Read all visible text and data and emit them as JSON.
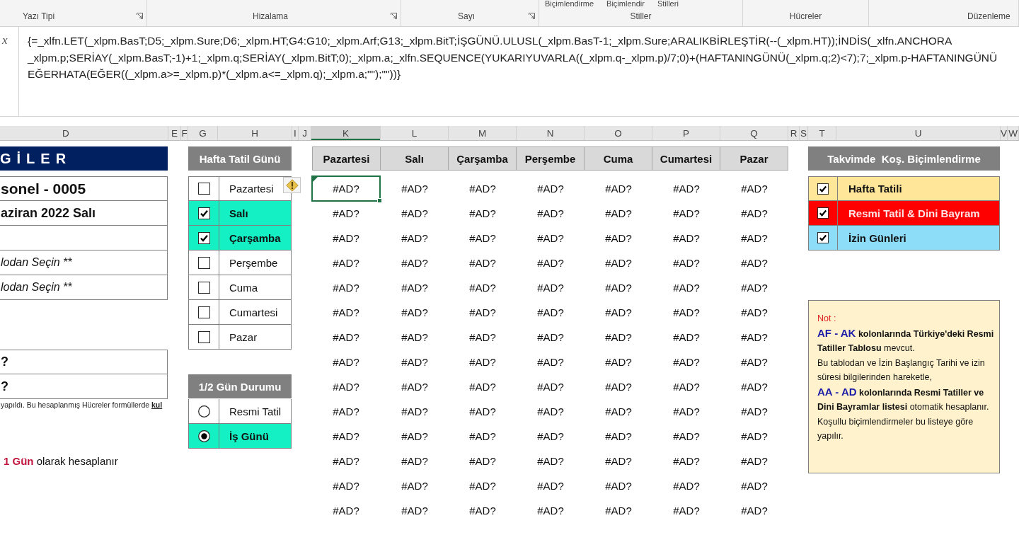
{
  "ribbon": {
    "groups": [
      {
        "label": "Yazı Tipi",
        "launcher": true
      },
      {
        "label": "Hizalama",
        "launcher": true
      },
      {
        "label": "Sayı",
        "launcher": true
      },
      {
        "label": "Stiller",
        "launcher": false,
        "button_labels": [
          "Biçimlendirme",
          "Biçimlendir",
          "Stilleri"
        ]
      },
      {
        "label": "Hücreler",
        "launcher": false
      },
      {
        "label": "Düzenleme",
        "launcher": false
      }
    ]
  },
  "formula_bar": {
    "function_button": "x",
    "lines": [
      "{=_xlfn.LET(_xlpm.BasT;D5;_xlpm.Sure;D6;_xlpm.HT;G4:G10;_xlpm.Arf;G13;_xlpm.BitT;İŞGÜNÜ.ULUSL(_xlpm.BasT-1;_xlpm.Sure;ARALIKBİRLEŞTİR(--(_xlpm.HT));İNDİS(_xlfn.ANCHORA",
      "_xlpm.p;SERİAY(_xlpm.BasT;-1)+1;_xlpm.q;SERİAY(_xlpm.BitT;0);_xlpm.a;_xlfn.SEQUENCE(YUKARIYUVARLA((_xlpm.q-_xlpm.p)/7;0)+(HAFTANINGÜNÜ(_xlpm.q;2)<7);7;_xlpm.p-HAFTANINGÜNÜ",
      "EĞERHATA(EĞER((_xlpm.a>=_xlpm.p)*(_xlpm.a<=_xlpm.q);_xlpm.a;\"\");\"\"))}"
    ]
  },
  "columns": [
    {
      "label": "D",
      "selected": false
    },
    {
      "label": "E",
      "selected": false
    },
    {
      "label": "F",
      "selected": false
    },
    {
      "label": "G",
      "selected": false
    },
    {
      "label": "H",
      "selected": false
    },
    {
      "label": "I",
      "selected": false
    },
    {
      "label": "J",
      "selected": false
    },
    {
      "label": "K",
      "selected": true
    },
    {
      "label": "L",
      "selected": false
    },
    {
      "label": "M",
      "selected": false
    },
    {
      "label": "N",
      "selected": false
    },
    {
      "label": "O",
      "selected": false
    },
    {
      "label": "P",
      "selected": false
    },
    {
      "label": "Q",
      "selected": false
    },
    {
      "label": "R",
      "selected": false
    },
    {
      "label": "S",
      "selected": false
    },
    {
      "label": "T",
      "selected": false
    },
    {
      "label": "U",
      "selected": false
    },
    {
      "label": "V",
      "selected": false
    },
    {
      "label": "W",
      "selected": false
    }
  ],
  "info_panel": {
    "title": "GİLER",
    "fields": [
      {
        "kind": "heading",
        "text": "sonel - 0005"
      },
      {
        "kind": "bold",
        "text": "aziran 2022 Salı"
      },
      {
        "kind": "blank"
      },
      {
        "kind": "italic",
        "text": "lodan Seçin **"
      },
      {
        "kind": "italic",
        "text": "lodan Seçin **"
      }
    ],
    "results": [
      {
        "kind": "bold",
        "text": "?"
      },
      {
        "kind": "bold",
        "text": "?"
      }
    ],
    "footnote": "yapıldı. Bu hesaplanmış Hücreler formüllerde **kul**",
    "summary": [
      {
        "kind": "highlight",
        "text": "1 Gün"
      },
      {
        "kind": "plain",
        "text": " olarak hesaplanır"
      }
    ]
  },
  "weekend_picker": {
    "title": "Hafta Tatil Günü",
    "days": [
      {
        "label": "Pazartesi",
        "checked": false
      },
      {
        "label": "Salı",
        "checked": true
      },
      {
        "label": "Çarşamba",
        "checked": true
      },
      {
        "label": "Perşembe",
        "checked": false
      },
      {
        "label": "Cuma",
        "checked": false
      },
      {
        "label": "Cumartesi",
        "checked": false
      },
      {
        "label": "Pazar",
        "checked": false
      }
    ]
  },
  "half_day": {
    "title": "1/2 Gün Durumu",
    "options": [
      {
        "label": "Resmi Tatil",
        "selected": false
      },
      {
        "label": "İş Günü",
        "selected": true
      }
    ]
  },
  "calendar": {
    "weekdays": [
      "Pazartesi",
      "Salı",
      "Çarşamba",
      "Perşembe",
      "Cuma",
      "Cumartesi",
      "Pazar"
    ],
    "rows": [
      {
        "cells": [
          {
            "text": "#AD?",
            "selected": true
          },
          {
            "text": "#AD?",
            "selected": false
          },
          {
            "text": "#AD?",
            "selected": false
          },
          {
            "text": "#AD?",
            "selected": false
          },
          {
            "text": "#AD?",
            "selected": false
          },
          {
            "text": "#AD?",
            "selected": false
          },
          {
            "text": "#AD?",
            "selected": false
          }
        ]
      },
      {
        "cells": [
          {
            "text": "#AD?",
            "selected": false
          },
          {
            "text": "#AD?",
            "selected": false
          },
          {
            "text": "#AD?",
            "selected": false
          },
          {
            "text": "#AD?",
            "selected": false
          },
          {
            "text": "#AD?",
            "selected": false
          },
          {
            "text": "#AD?",
            "selected": false
          },
          {
            "text": "#AD?",
            "selected": false
          }
        ]
      },
      {
        "cells": [
          {
            "text": "#AD?",
            "selected": false
          },
          {
            "text": "#AD?",
            "selected": false
          },
          {
            "text": "#AD?",
            "selected": false
          },
          {
            "text": "#AD?",
            "selected": false
          },
          {
            "text": "#AD?",
            "selected": false
          },
          {
            "text": "#AD?",
            "selected": false
          },
          {
            "text": "#AD?",
            "selected": false
          }
        ]
      },
      {
        "cells": [
          {
            "text": "#AD?",
            "selected": false
          },
          {
            "text": "#AD?",
            "selected": false
          },
          {
            "text": "#AD?",
            "selected": false
          },
          {
            "text": "#AD?",
            "selected": false
          },
          {
            "text": "#AD?",
            "selected": false
          },
          {
            "text": "#AD?",
            "selected": false
          },
          {
            "text": "#AD?",
            "selected": false
          }
        ]
      },
      {
        "cells": [
          {
            "text": "#AD?",
            "selected": false
          },
          {
            "text": "#AD?",
            "selected": false
          },
          {
            "text": "#AD?",
            "selected": false
          },
          {
            "text": "#AD?",
            "selected": false
          },
          {
            "text": "#AD?",
            "selected": false
          },
          {
            "text": "#AD?",
            "selected": false
          },
          {
            "text": "#AD?",
            "selected": false
          }
        ]
      },
      {
        "cells": [
          {
            "text": "#AD?",
            "selected": false
          },
          {
            "text": "#AD?",
            "selected": false
          },
          {
            "text": "#AD?",
            "selected": false
          },
          {
            "text": "#AD?",
            "selected": false
          },
          {
            "text": "#AD?",
            "selected": false
          },
          {
            "text": "#AD?",
            "selected": false
          },
          {
            "text": "#AD?",
            "selected": false
          }
        ]
      },
      {
        "cells": [
          {
            "text": "#AD?",
            "selected": false
          },
          {
            "text": "#AD?",
            "selected": false
          },
          {
            "text": "#AD?",
            "selected": false
          },
          {
            "text": "#AD?",
            "selected": false
          },
          {
            "text": "#AD?",
            "selected": false
          },
          {
            "text": "#AD?",
            "selected": false
          },
          {
            "text": "#AD?",
            "selected": false
          }
        ]
      },
      {
        "cells": [
          {
            "text": "#AD?",
            "selected": false
          },
          {
            "text": "#AD?",
            "selected": false
          },
          {
            "text": "#AD?",
            "selected": false
          },
          {
            "text": "#AD?",
            "selected": false
          },
          {
            "text": "#AD?",
            "selected": false
          },
          {
            "text": "#AD?",
            "selected": false
          },
          {
            "text": "#AD?",
            "selected": false
          }
        ]
      },
      {
        "cells": [
          {
            "text": "#AD?",
            "selected": false
          },
          {
            "text": "#AD?",
            "selected": false
          },
          {
            "text": "#AD?",
            "selected": false
          },
          {
            "text": "#AD?",
            "selected": false
          },
          {
            "text": "#AD?",
            "selected": false
          },
          {
            "text": "#AD?",
            "selected": false
          },
          {
            "text": "#AD?",
            "selected": false
          }
        ]
      },
      {
        "cells": [
          {
            "text": "#AD?",
            "selected": false
          },
          {
            "text": "#AD?",
            "selected": false
          },
          {
            "text": "#AD?",
            "selected": false
          },
          {
            "text": "#AD?",
            "selected": false
          },
          {
            "text": "#AD?",
            "selected": false
          },
          {
            "text": "#AD?",
            "selected": false
          },
          {
            "text": "#AD?",
            "selected": false
          }
        ]
      },
      {
        "cells": [
          {
            "text": "#AD?",
            "selected": false
          },
          {
            "text": "#AD?",
            "selected": false
          },
          {
            "text": "#AD?",
            "selected": false
          },
          {
            "text": "#AD?",
            "selected": false
          },
          {
            "text": "#AD?",
            "selected": false
          },
          {
            "text": "#AD?",
            "selected": false
          },
          {
            "text": "#AD?",
            "selected": false
          }
        ]
      },
      {
        "cells": [
          {
            "text": "#AD?",
            "selected": false
          },
          {
            "text": "#AD?",
            "selected": false
          },
          {
            "text": "#AD?",
            "selected": false
          },
          {
            "text": "#AD?",
            "selected": false
          },
          {
            "text": "#AD?",
            "selected": false
          },
          {
            "text": "#AD?",
            "selected": false
          },
          {
            "text": "#AD?",
            "selected": false
          }
        ]
      },
      {
        "cells": [
          {
            "text": "#AD?",
            "selected": false
          },
          {
            "text": "#AD?",
            "selected": false
          },
          {
            "text": "#AD?",
            "selected": false
          },
          {
            "text": "#AD?",
            "selected": false
          },
          {
            "text": "#AD?",
            "selected": false
          },
          {
            "text": "#AD?",
            "selected": false
          },
          {
            "text": "#AD?",
            "selected": false
          }
        ]
      },
      {
        "cells": [
          {
            "text": "#AD?",
            "selected": false
          },
          {
            "text": "#AD?",
            "selected": false
          },
          {
            "text": "#AD?",
            "selected": false
          },
          {
            "text": "#AD?",
            "selected": false
          },
          {
            "text": "#AD?",
            "selected": false
          },
          {
            "text": "#AD?",
            "selected": false
          },
          {
            "text": "#AD?",
            "selected": false
          }
        ]
      }
    ]
  },
  "highlight_rules": {
    "title": "Takvimde  Koş. Biçimlendirme",
    "rules": [
      {
        "label": "Hafta Tatili",
        "checked": true,
        "color": "#ffe699"
      },
      {
        "label": "Resmi Tatil & Dini Bayram",
        "checked": true,
        "color": "#ff0000"
      },
      {
        "label": "İzin Günleri",
        "checked": true,
        "color": "#8ddcf8"
      }
    ]
  },
  "note": {
    "paragraphs": [
      [
        {
          "kind": "label",
          "text": "Not :"
        }
      ],
      [
        {
          "kind": "ref",
          "text": "AF - AK"
        },
        {
          "kind": "bold",
          "text": " kolonlarında Türkiye'deki Resmi Tatiller Tablosu"
        },
        {
          "kind": "plain",
          "text": " mevcut."
        }
      ],
      [
        {
          "kind": "plain",
          "text": "Bu tablodan ve İzin Başlangıç Tarihi ve izin süresi bilgilerinden hareketle,"
        }
      ],
      [
        {
          "kind": "ref",
          "text": "AA - AD"
        },
        {
          "kind": "bold",
          "text": " kolonlarında Resmi Tatiller ve Dini Bayramlar listesi"
        },
        {
          "kind": "plain",
          "text": " otomatik hesaplanır."
        }
      ],
      [
        {
          "kind": "plain",
          "text": "Koşullu biçimlendirmeler bu listeye göre yapılır."
        }
      ]
    ]
  }
}
